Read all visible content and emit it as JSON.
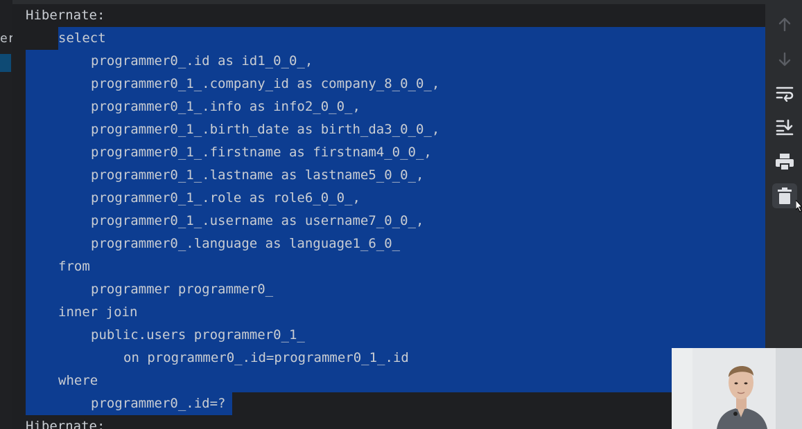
{
  "console": {
    "lines": [
      {
        "text": "Hibernate:",
        "indent": 0,
        "selected": false
      },
      {
        "text": "select",
        "indent": 1,
        "selected": true,
        "sel_from_text": true
      },
      {
        "text": "programmer0_.id as id1_0_0_,",
        "indent": 2,
        "selected": true
      },
      {
        "text": "programmer0_1_.company_id as company_8_0_0_,",
        "indent": 2,
        "selected": true
      },
      {
        "text": "programmer0_1_.info as info2_0_0_,",
        "indent": 2,
        "selected": true
      },
      {
        "text": "programmer0_1_.birth_date as birth_da3_0_0_,",
        "indent": 2,
        "selected": true
      },
      {
        "text": "programmer0_1_.firstname as firstnam4_0_0_,",
        "indent": 2,
        "selected": true
      },
      {
        "text": "programmer0_1_.lastname as lastname5_0_0_,",
        "indent": 2,
        "selected": true
      },
      {
        "text": "programmer0_1_.role as role6_0_0_,",
        "indent": 2,
        "selected": true
      },
      {
        "text": "programmer0_1_.username as username7_0_0_,",
        "indent": 2,
        "selected": true
      },
      {
        "text": "programmer0_.language as language1_6_0_",
        "indent": 2,
        "selected": true
      },
      {
        "text": "from",
        "indent": 1,
        "selected": true
      },
      {
        "text": "programmer programmer0_",
        "indent": 2,
        "selected": true
      },
      {
        "text": "inner join",
        "indent": 1,
        "selected": true
      },
      {
        "text": "public.users programmer0_1_",
        "indent": 2,
        "selected": true
      },
      {
        "text": "on programmer0_.id=programmer0_1_.id",
        "indent": 3,
        "selected": true
      },
      {
        "text": "where",
        "indent": 1,
        "selected": true
      },
      {
        "text": "programmer0_.id=?",
        "indent": 2,
        "selected": true,
        "sel_to_text_end": true
      },
      {
        "text": "Hibernate:",
        "indent": 0,
        "selected": false
      }
    ]
  },
  "left_panel": {
    "fragment": "er"
  },
  "toolbar": {
    "buttons": [
      {
        "name": "scroll-up-button",
        "icon": "arrow-up-icon",
        "enabled": false
      },
      {
        "name": "scroll-down-button",
        "icon": "arrow-down-icon",
        "enabled": false
      },
      {
        "name": "soft-wrap-button",
        "icon": "soft-wrap-icon",
        "enabled": true
      },
      {
        "name": "scroll-to-end-button",
        "icon": "scroll-to-end-icon",
        "enabled": true
      },
      {
        "name": "print-button",
        "icon": "print-icon",
        "enabled": true
      },
      {
        "name": "clear-all-button",
        "icon": "trash-icon",
        "enabled": true,
        "active": true
      }
    ]
  },
  "colors": {
    "selection": "#0d3d91",
    "console_bg": "#1e1f22",
    "text": "#c9cdd3",
    "toolbar_icon": "#dfe1e5",
    "toolbar_icon_disabled": "#5a5d63"
  }
}
